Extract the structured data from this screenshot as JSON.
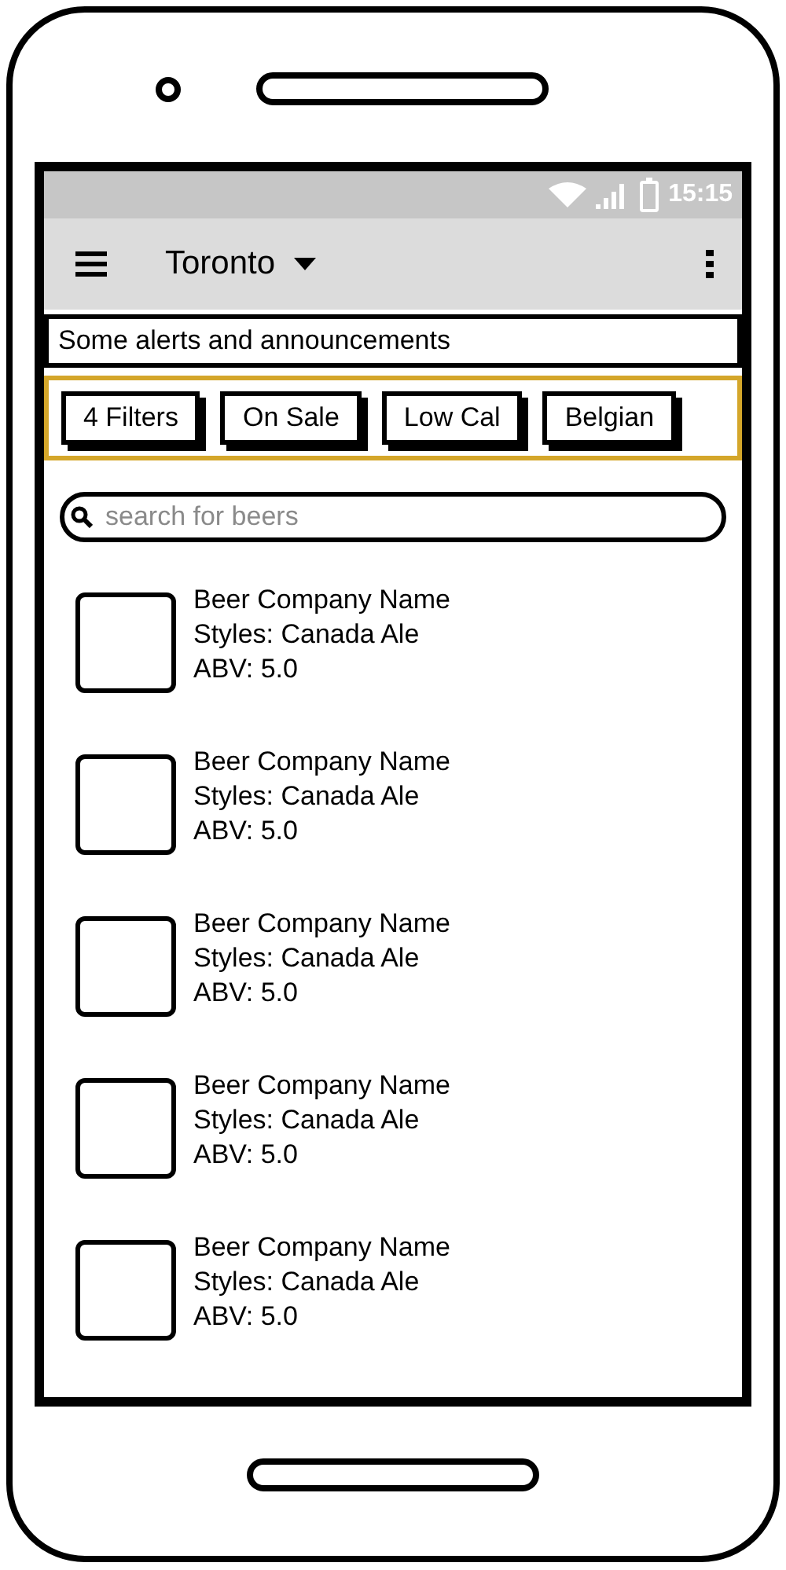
{
  "status_bar": {
    "time": "15:15"
  },
  "toolbar": {
    "title": "Toronto"
  },
  "alert": {
    "text": "Some alerts and announcements"
  },
  "filters": [
    {
      "label": "4 Filters"
    },
    {
      "label": "On Sale"
    },
    {
      "label": "Low Cal"
    },
    {
      "label": "Belgian"
    }
  ],
  "search": {
    "placeholder": "search for beers"
  },
  "beers": [
    {
      "name": "Beer Company Name",
      "styles": "Styles: Canada Ale",
      "abv": "ABV: 5.0"
    },
    {
      "name": "Beer Company Name",
      "styles": "Styles: Canada Ale",
      "abv": "ABV: 5.0"
    },
    {
      "name": "Beer Company Name",
      "styles": "Styles: Canada Ale",
      "abv": "ABV: 5.0"
    },
    {
      "name": "Beer Company Name",
      "styles": "Styles: Canada Ale",
      "abv": "ABV: 5.0"
    },
    {
      "name": "Beer Company Name",
      "styles": "Styles: Canada Ale",
      "abv": "ABV: 5.0"
    }
  ]
}
